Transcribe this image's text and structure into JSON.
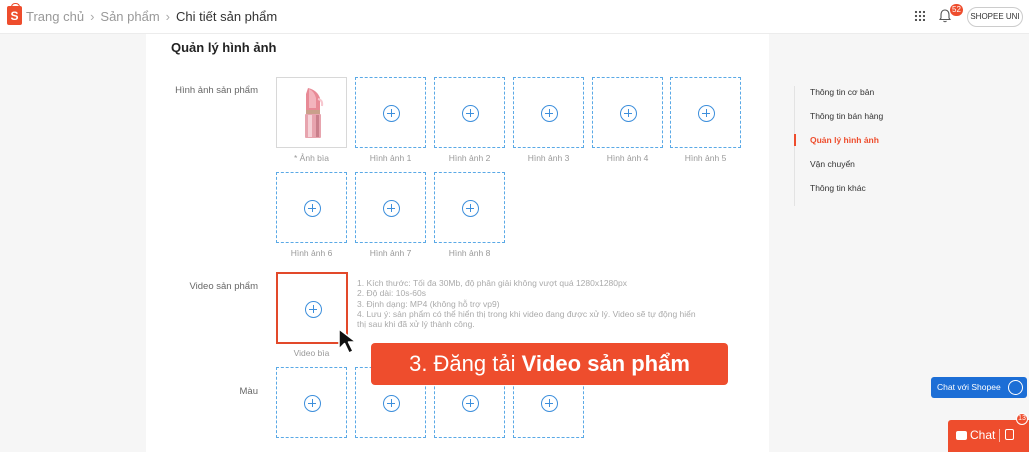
{
  "header": {
    "breadcrumb": [
      "Trang chủ",
      "Sản phẩm",
      "Chi tiết sản phẩm"
    ],
    "notification_count": "52",
    "shop_name": "SHOPEE UNI"
  },
  "section": {
    "title": "Quản lý hình ảnh",
    "product_images_label": "Hình ảnh sản phẩm",
    "product_video_label": "Video sản phẩm",
    "color_label": "Màu"
  },
  "image_slots": [
    "* Ảnh bìa",
    "Hình ảnh 1",
    "Hình ảnh 2",
    "Hình ảnh 3",
    "Hình ảnh 4",
    "Hình ảnh 5",
    "Hình ảnh 6",
    "Hình ảnh 7",
    "Hình ảnh 8"
  ],
  "video": {
    "slot_label": "Video bìa",
    "notes": [
      "1. Kích thước: Tối đa 30Mb, độ phân giải không vượt quá 1280x1280px",
      "2. Độ dài: 10s-60s",
      "3. Định dạng: MP4 (không hỗ trợ vp9)",
      "4. Lưu ý: sản phẩm có thể hiển thị trong khi video đang được xử lý. Video sẽ tự động hiển thị sau khi đã xử lý thành công."
    ]
  },
  "sidenav": {
    "items": [
      "Thông tin cơ bản",
      "Thông tin bán hàng",
      "Quản lý hình ảnh",
      "Vận chuyển",
      "Thông tin khác"
    ],
    "active": "Quản lý hình ảnh"
  },
  "callout": {
    "prefix": "3. Đăng tải ",
    "bold": "Video sản phẩm"
  },
  "floating": {
    "chat_shopee": "Chat với Shopee",
    "chat": "Chat",
    "chat_badge": "13"
  },
  "colors": {
    "accent": "#ee4d2d",
    "slot_border": "#5aa9e6",
    "chat_shopee_bg": "#1c6ed6"
  }
}
